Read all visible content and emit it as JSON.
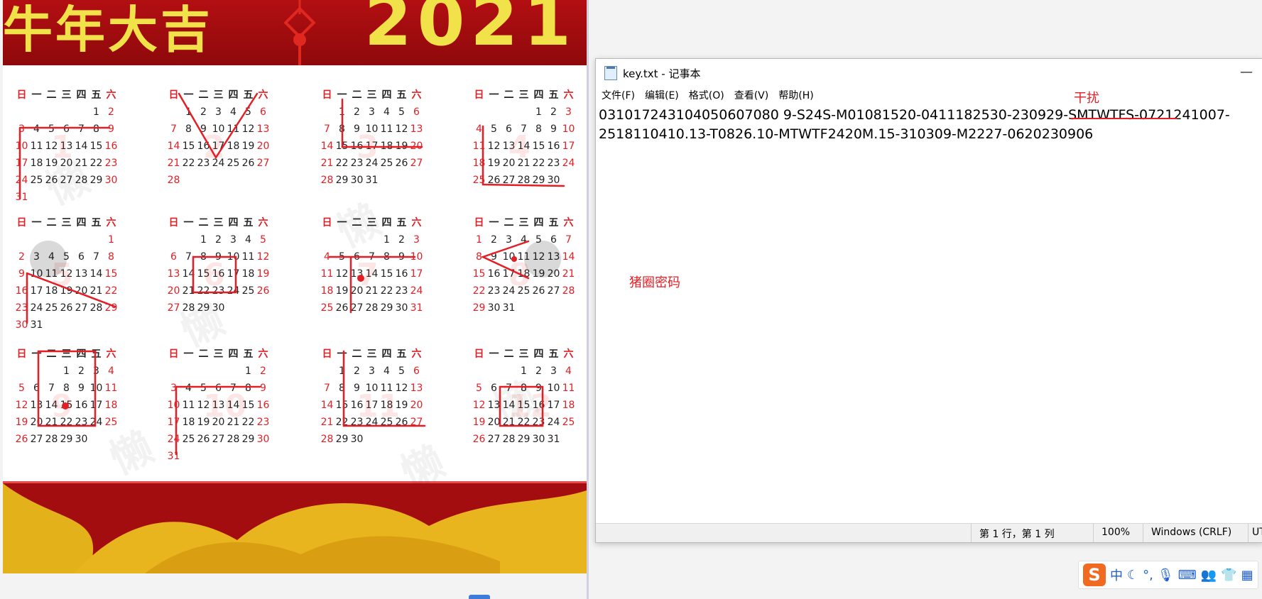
{
  "poster": {
    "banner_left": "牛年大吉",
    "banner_year": "2021",
    "months": [
      {
        "n": "1",
        "head": [
          "日",
          "一",
          "二",
          "三",
          "四",
          "五",
          "六"
        ],
        "rows": [
          [
            "",
            "",
            "",
            "",
            "",
            "1",
            "2"
          ],
          [
            "3",
            "4",
            "5",
            "6",
            "7",
            "8",
            "9"
          ],
          [
            "10",
            "11",
            "12",
            "13",
            "14",
            "15",
            "16"
          ],
          [
            "17",
            "18",
            "19",
            "20",
            "21",
            "22",
            "23"
          ],
          [
            "24",
            "25",
            "26",
            "27",
            "28",
            "29",
            "30"
          ],
          [
            "31",
            "",
            "",
            "",
            "",
            "",
            ""
          ]
        ]
      },
      {
        "n": "2",
        "head": [
          "日",
          "一",
          "二",
          "三",
          "四",
          "五",
          "六"
        ],
        "rows": [
          [
            "",
            "1",
            "2",
            "3",
            "4",
            "5",
            "6"
          ],
          [
            "7",
            "8",
            "9",
            "10",
            "11",
            "12",
            "13"
          ],
          [
            "14",
            "15",
            "16",
            "17",
            "18",
            "19",
            "20"
          ],
          [
            "21",
            "22",
            "23",
            "24",
            "25",
            "26",
            "27"
          ],
          [
            "28",
            "",
            "",
            "",
            "",
            "",
            ""
          ]
        ]
      },
      {
        "n": "3",
        "head": [
          "日",
          "一",
          "二",
          "三",
          "四",
          "五",
          "六"
        ],
        "rows": [
          [
            "",
            "1",
            "2",
            "3",
            "4",
            "5",
            "6"
          ],
          [
            "7",
            "8",
            "9",
            "10",
            "11",
            "12",
            "13"
          ],
          [
            "14",
            "15",
            "16",
            "17",
            "18",
            "19",
            "20"
          ],
          [
            "21",
            "22",
            "23",
            "24",
            "25",
            "26",
            "27"
          ],
          [
            "28",
            "29",
            "30",
            "31",
            "",
            "",
            ""
          ]
        ]
      },
      {
        "n": "4",
        "head": [
          "日",
          "一",
          "二",
          "三",
          "四",
          "五",
          "六"
        ],
        "rows": [
          [
            "",
            "",
            "",
            "",
            "1",
            "2",
            "3"
          ],
          [
            "4",
            "5",
            "6",
            "7",
            "8",
            "9",
            "10"
          ],
          [
            "11",
            "12",
            "13",
            "14",
            "15",
            "16",
            "17"
          ],
          [
            "18",
            "19",
            "20",
            "21",
            "22",
            "23",
            "24"
          ],
          [
            "25",
            "26",
            "27",
            "28",
            "29",
            "30",
            ""
          ]
        ]
      },
      {
        "n": "5",
        "head": [
          "日",
          "一",
          "二",
          "三",
          "四",
          "五",
          "六"
        ],
        "rows": [
          [
            "",
            "",
            "",
            "",
            "",
            "",
            "1"
          ],
          [
            "2",
            "3",
            "4",
            "5",
            "6",
            "7",
            "8"
          ],
          [
            "9",
            "10",
            "11",
            "12",
            "13",
            "14",
            "15"
          ],
          [
            "16",
            "17",
            "18",
            "19",
            "20",
            "21",
            "22"
          ],
          [
            "23",
            "24",
            "25",
            "26",
            "27",
            "28",
            "29"
          ],
          [
            "30",
            "31",
            "",
            "",
            "",
            "",
            ""
          ]
        ]
      },
      {
        "n": "6",
        "head": [
          "日",
          "一",
          "二",
          "三",
          "四",
          "五",
          "六"
        ],
        "rows": [
          [
            "",
            "",
            "1",
            "2",
            "3",
            "4",
            "5"
          ],
          [
            "6",
            "7",
            "8",
            "9",
            "10",
            "11",
            "12"
          ],
          [
            "13",
            "14",
            "15",
            "16",
            "17",
            "18",
            "19"
          ],
          [
            "20",
            "21",
            "22",
            "23",
            "24",
            "25",
            "26"
          ],
          [
            "27",
            "28",
            "29",
            "30",
            "",
            "",
            ""
          ]
        ]
      },
      {
        "n": "7",
        "head": [
          "日",
          "一",
          "二",
          "三",
          "四",
          "五",
          "六"
        ],
        "rows": [
          [
            "",
            "",
            "",
            "",
            "1",
            "2",
            "3"
          ],
          [
            "4",
            "5",
            "6",
            "7",
            "8",
            "9",
            "10"
          ],
          [
            "11",
            "12",
            "13",
            "14",
            "15",
            "16",
            "17"
          ],
          [
            "18",
            "19",
            "20",
            "21",
            "22",
            "23",
            "24"
          ],
          [
            "25",
            "26",
            "27",
            "28",
            "29",
            "30",
            "31"
          ]
        ]
      },
      {
        "n": "8",
        "head": [
          "日",
          "一",
          "二",
          "三",
          "四",
          "五",
          "六"
        ],
        "rows": [
          [
            "1",
            "2",
            "3",
            "4",
            "5",
            "6",
            "7"
          ],
          [
            "8",
            "9",
            "10",
            "11",
            "12",
            "13",
            "14"
          ],
          [
            "15",
            "16",
            "17",
            "18",
            "19",
            "20",
            "21"
          ],
          [
            "22",
            "23",
            "24",
            "25",
            "26",
            "27",
            "28"
          ],
          [
            "29",
            "30",
            "31",
            "",
            "",
            "",
            ""
          ]
        ]
      },
      {
        "n": "9",
        "head": [
          "日",
          "一",
          "二",
          "三",
          "四",
          "五",
          "六"
        ],
        "rows": [
          [
            "",
            "",
            "",
            "1",
            "2",
            "3",
            "4"
          ],
          [
            "5",
            "6",
            "7",
            "8",
            "9",
            "10",
            "11"
          ],
          [
            "12",
            "13",
            "14",
            "15",
            "16",
            "17",
            "18"
          ],
          [
            "19",
            "20",
            "21",
            "22",
            "23",
            "24",
            "25"
          ],
          [
            "26",
            "27",
            "28",
            "29",
            "30",
            "",
            ""
          ]
        ]
      },
      {
        "n": "10",
        "head": [
          "日",
          "一",
          "二",
          "三",
          "四",
          "五",
          "六"
        ],
        "rows": [
          [
            "",
            "",
            "",
            "",
            "",
            "1",
            "2"
          ],
          [
            "3",
            "4",
            "5",
            "6",
            "7",
            "8",
            "9"
          ],
          [
            "10",
            "11",
            "12",
            "13",
            "14",
            "15",
            "16"
          ],
          [
            "17",
            "18",
            "19",
            "20",
            "21",
            "22",
            "23"
          ],
          [
            "24",
            "25",
            "26",
            "27",
            "28",
            "29",
            "30"
          ],
          [
            "31",
            "",
            "",
            "",
            "",
            "",
            ""
          ]
        ]
      },
      {
        "n": "11",
        "head": [
          "日",
          "一",
          "二",
          "三",
          "四",
          "五",
          "六"
        ],
        "rows": [
          [
            "",
            "1",
            "2",
            "3",
            "4",
            "5",
            "6"
          ],
          [
            "7",
            "8",
            "9",
            "10",
            "11",
            "12",
            "13"
          ],
          [
            "14",
            "15",
            "16",
            "17",
            "18",
            "19",
            "20"
          ],
          [
            "21",
            "22",
            "23",
            "24",
            "25",
            "26",
            "27"
          ],
          [
            "28",
            "29",
            "30",
            "",
            "",
            "",
            ""
          ]
        ]
      },
      {
        "n": "12",
        "head": [
          "日",
          "一",
          "二",
          "三",
          "四",
          "五",
          "六"
        ],
        "rows": [
          [
            "",
            "",
            "",
            "1",
            "2",
            "3",
            "4"
          ],
          [
            "5",
            "6",
            "7",
            "8",
            "9",
            "10",
            "11"
          ],
          [
            "12",
            "13",
            "14",
            "15",
            "16",
            "17",
            "18"
          ],
          [
            "19",
            "20",
            "21",
            "22",
            "23",
            "24",
            "25"
          ],
          [
            "26",
            "27",
            "28",
            "29",
            "30",
            "31",
            ""
          ]
        ]
      }
    ]
  },
  "notepad": {
    "title": "key.txt - 记事本",
    "minimize": "—",
    "menu": [
      "文件(F)",
      "编辑(E)",
      "格式(O)",
      "查看(V)",
      "帮助(H)"
    ],
    "content": "031017243104050607080 9-S24S-M01081520-0411182530-230929-SMTWTFS-0721241007-\n2518110410.13-T0826.10-MTWTF2420M.15-310309-M2227-0620230906",
    "status": {
      "position": "第 1 行，第 1 列",
      "zoom": "100%",
      "eol": "Windows (CRLF)",
      "encoding": "UT"
    }
  },
  "annotations": {
    "interference": "干扰",
    "pigpen": "猪圈密码"
  },
  "ime": {
    "logo": "S",
    "mode": "中"
  }
}
